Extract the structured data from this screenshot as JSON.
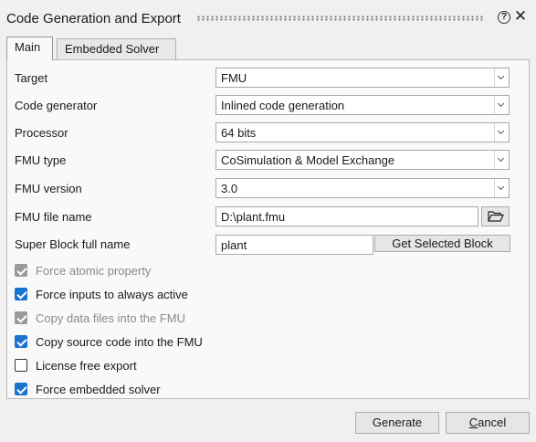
{
  "window": {
    "title": "Code Generation and Export",
    "help_icon": "help-icon",
    "close_icon": "close-icon"
  },
  "tabs": [
    {
      "label": "Main",
      "active": true
    },
    {
      "label": "Embedded Solver",
      "active": false
    }
  ],
  "fields": {
    "target": {
      "label": "Target",
      "value": "FMU"
    },
    "code_generator": {
      "label": "Code generator",
      "value": "Inlined code generation"
    },
    "processor": {
      "label": "Processor",
      "value": "64 bits"
    },
    "fmu_type": {
      "label": "FMU type",
      "value": "CoSimulation & Model Exchange"
    },
    "fmu_version": {
      "label": "FMU version",
      "value": "3.0"
    },
    "fmu_file_name": {
      "label": "FMU file name",
      "value": "D:\\plant.fmu",
      "browse_icon": "folder-open-icon"
    },
    "super_block": {
      "label": "Super Block full name",
      "value": "plant",
      "button_label": "Get Selected Block"
    }
  },
  "options": [
    {
      "label": "Force atomic property",
      "checked": true,
      "enabled": false
    },
    {
      "label": "Force inputs to always active",
      "checked": true,
      "enabled": true
    },
    {
      "label": "Copy data files into the FMU",
      "checked": true,
      "enabled": false
    },
    {
      "label": "Copy source code into the FMU",
      "checked": true,
      "enabled": true
    },
    {
      "label": "License free export",
      "checked": false,
      "enabled": true
    },
    {
      "label": "Force embedded solver",
      "checked": true,
      "enabled": true
    }
  ],
  "footer": {
    "generate_label": "Generate",
    "cancel_label_first": "C",
    "cancel_label_rest": "ancel"
  },
  "colors": {
    "check_accent": "#1a73d0",
    "check_disabled": "#9a9a9a"
  }
}
